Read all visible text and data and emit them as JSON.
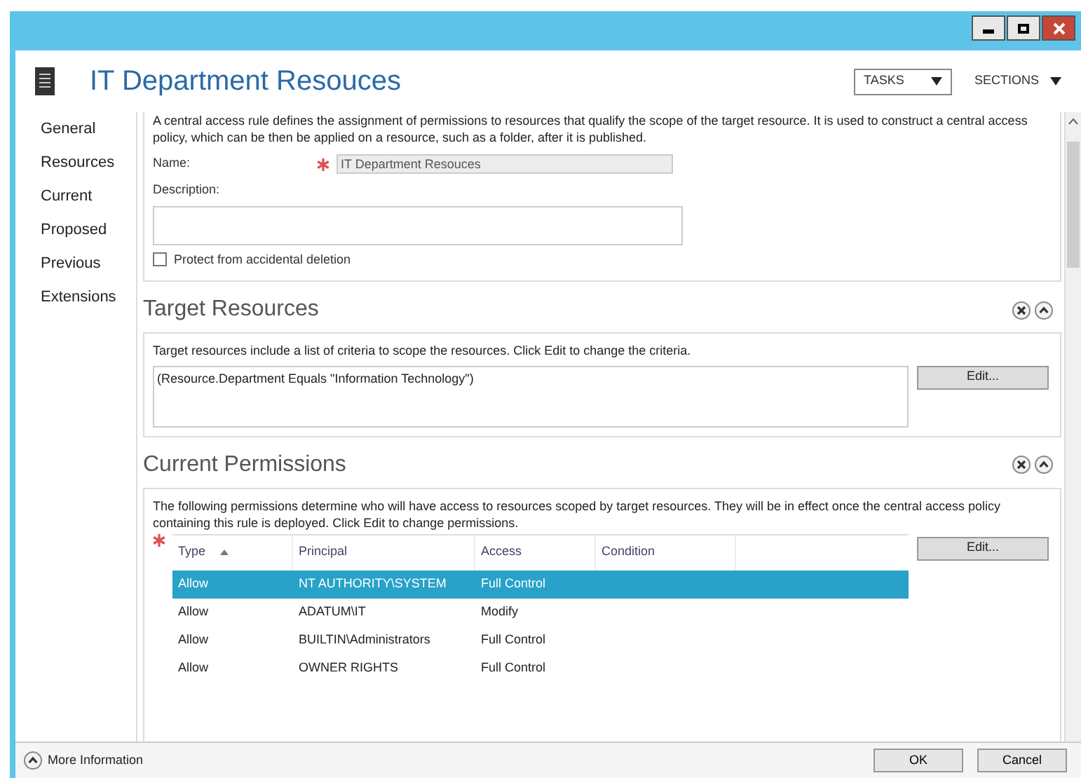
{
  "window": {
    "title_buttons": [
      {
        "kind": "minimize"
      },
      {
        "kind": "maximize"
      },
      {
        "kind": "close"
      }
    ]
  },
  "header": {
    "title": "IT Department Resouces",
    "tasks": "TASKS",
    "sections": "SECTIONS"
  },
  "nav": [
    {
      "label": "General"
    },
    {
      "label": "Resources"
    },
    {
      "label": "Current"
    },
    {
      "label": "Proposed"
    },
    {
      "label": "Previous"
    },
    {
      "label": "Extensions"
    }
  ],
  "general": {
    "description": "A central access rule defines the assignment of permissions to resources that qualify the scope of the target resource. It is used to construct a central access policy, which can be then be applied on a resource, such as a folder, after it is published.",
    "name_label": "Name:",
    "name_value": "IT Department Resouces",
    "description_label": "Description:",
    "protect": {
      "label": "Protect from accidental deletion",
      "checked": false
    }
  },
  "target_resources": {
    "title": "Target Resources",
    "hint": "Target resources include a list of criteria to scope the resources. Click Edit to change the criteria.",
    "criteria": "(Resource.Department Equals \"Information Technology\")",
    "edit": "Edit..."
  },
  "current_permissions": {
    "title": "Current Permissions",
    "hint": "The following permissions determine who will have access to resources scoped by target resources. They will be in effect once the central access policy containing this rule is deployed. Click Edit to change permissions.",
    "edit": "Edit...",
    "columns": [
      "Type",
      "Principal",
      "Access",
      "Condition"
    ],
    "rows": [
      {
        "type": "Allow",
        "principal": "NT AUTHORITY\\SYSTEM",
        "access": "Full Control",
        "selected": true
      },
      {
        "type": "Allow",
        "principal": "ADATUM\\IT",
        "access": "Modify",
        "selected": false
      },
      {
        "type": "Allow",
        "principal": "BUILTIN\\Administrators",
        "access": "Full Control",
        "selected": false
      },
      {
        "type": "Allow",
        "principal": "OWNER RIGHTS",
        "access": "Full Control",
        "selected": false
      }
    ]
  },
  "footer": {
    "more_information": "More Information",
    "ok": "OK",
    "cancel": "Cancel"
  }
}
